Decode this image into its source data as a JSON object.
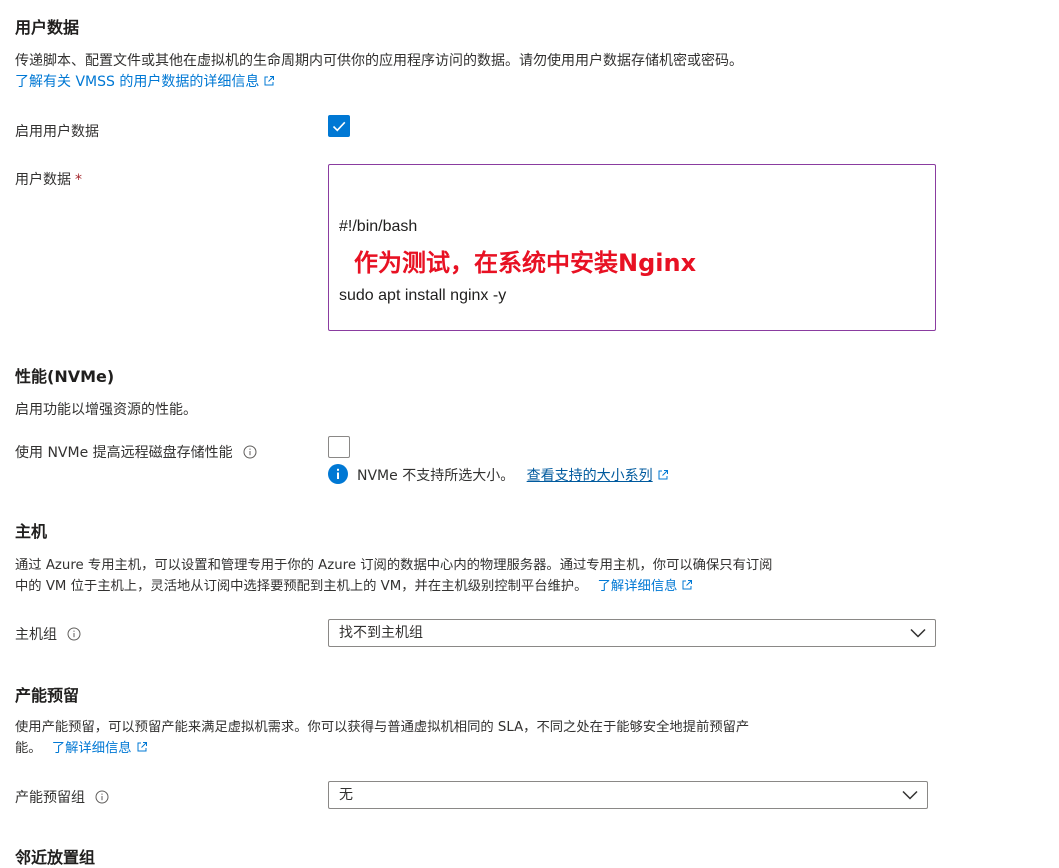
{
  "user_data": {
    "heading": "用户数据",
    "description": "传递脚本、配置文件或其他在虚拟机的生命周期内可供你的应用程序访问的数据。请勿使用用户数据存储机密或密码。",
    "learn_link": "了解有关 VMSS 的用户数据的详细信息",
    "enable_label": "启用用户数据",
    "enable_checked": true,
    "data_label": "用户数据",
    "required_mark": "*",
    "data_line1": "#!/bin/bash",
    "data_line2": "sudo apt install nginx -y",
    "annotation": "作为测试，在系统中安装Nginx"
  },
  "performance": {
    "heading": "性能(NVMe)",
    "description": "启用功能以增强资源的性能。",
    "nvme_label": "使用 NVMe 提高远程磁盘存储性能",
    "nvme_checked": false,
    "info_text": "NVMe 不支持所选大小。",
    "info_link": "查看支持的大小系列"
  },
  "host": {
    "heading": "主机",
    "description_line1": "通过 Azure 专用主机，可以设置和管理专用于你的 Azure 订阅的数据中心内的物理服务器。通过专用主机，你可以确保只有订阅",
    "description_line2": "中的 VM 位于主机上，灵活地从订阅中选择要预配到主机上的 VM，并在主机级别控制平台维护。",
    "learn_link": "了解详细信息",
    "group_label": "主机组",
    "group_value": "找不到主机组"
  },
  "capacity": {
    "heading": "产能预留",
    "description_line1": "使用产能预留，可以预留产能来满足虚拟机需求。你可以获得与普通虚拟机相同的 SLA，不同之处在于能够安全地提前预留产",
    "description_line2": "能。",
    "learn_link": "了解详细信息",
    "group_label": "产能预留组",
    "group_value": "无"
  },
  "proximity": {
    "heading": "邻近放置组"
  },
  "colors": {
    "link": "#0078d4",
    "checkbox_on": "#0078d4",
    "textarea_border": "#8a3ca0",
    "annotation": "#e81123",
    "info_icon": "#0078d4"
  }
}
